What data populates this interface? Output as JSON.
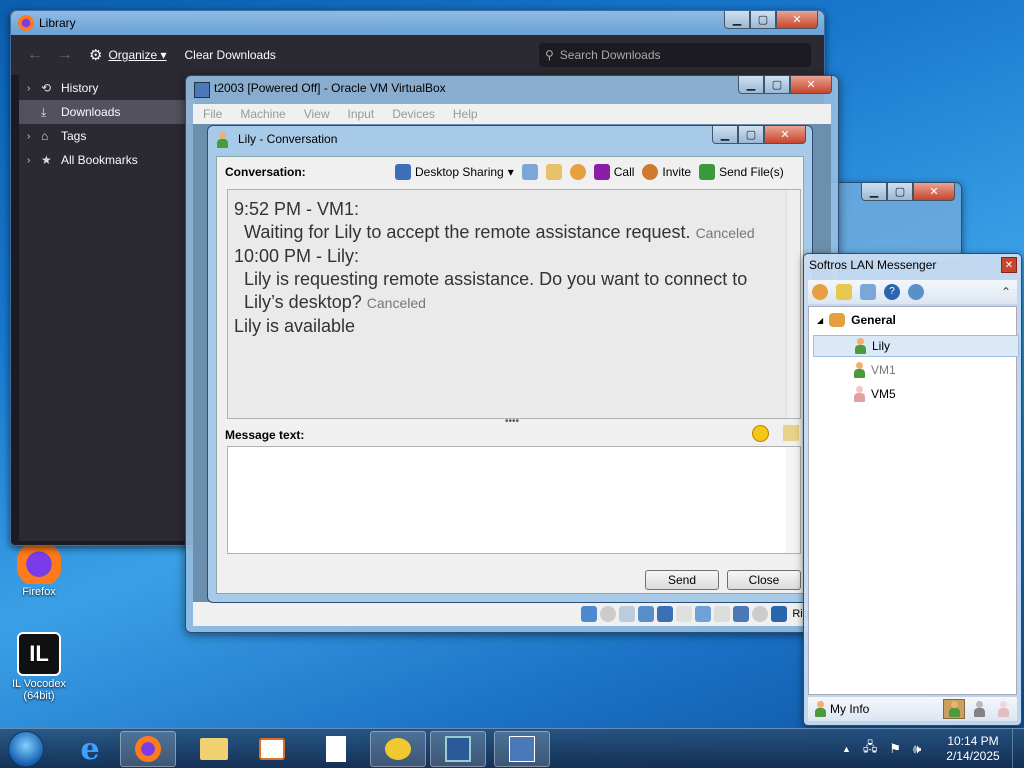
{
  "desktop": {
    "icons": [
      {
        "label": "Firefox"
      },
      {
        "label": "IL Vocodex\n(64bit)"
      }
    ]
  },
  "library": {
    "title": "Library",
    "toolbar": {
      "organize": "Organize",
      "clear": "Clear Downloads",
      "search_placeholder": "Search Downloads"
    },
    "sidebar": [
      {
        "label": "History",
        "icon": "history-icon"
      },
      {
        "label": "Downloads",
        "icon": "download-icon"
      },
      {
        "label": "Tags",
        "icon": "tag-icon"
      },
      {
        "label": "All Bookmarks",
        "icon": "star-icon"
      }
    ]
  },
  "vbox": {
    "title": "t2003 [Powered Off] - Oracle VM VirtualBox",
    "menu": [
      "File",
      "Machine",
      "View",
      "Input",
      "Devices",
      "Help"
    ],
    "host_key": "Right C"
  },
  "conversation": {
    "title": "Lily - Conversation",
    "label": "Conversation:",
    "toolbar": {
      "desktop_sharing": "Desktop Sharing",
      "call": "Call",
      "invite": "Invite",
      "send_files": "Send File(s)"
    },
    "messages": {
      "m1_header": "9:52 PM - VM1:",
      "m1_text": "Waiting for Lily to accept the remote assistance request.",
      "m1_status": "Canceled",
      "m2_header": "10:00 PM - Lily:",
      "m2_text_line1": "Lily is requesting remote assistance. Do you want to connect to",
      "m2_text_line2": "Lily’s desktop?",
      "m2_status": "Canceled",
      "m3": "Lily is available"
    },
    "message_label": "Message text:",
    "send": "Send",
    "close": "Close"
  },
  "softros": {
    "title": "Softros LAN Messenger",
    "group": "General",
    "users": [
      {
        "name": "Lily",
        "status": "online"
      },
      {
        "name": "VM1",
        "status": "online"
      },
      {
        "name": "VM5",
        "status": "offline"
      }
    ],
    "my_info": "My Info"
  },
  "taskbar": {
    "time": "10:14 PM",
    "date": "2/14/2025"
  }
}
